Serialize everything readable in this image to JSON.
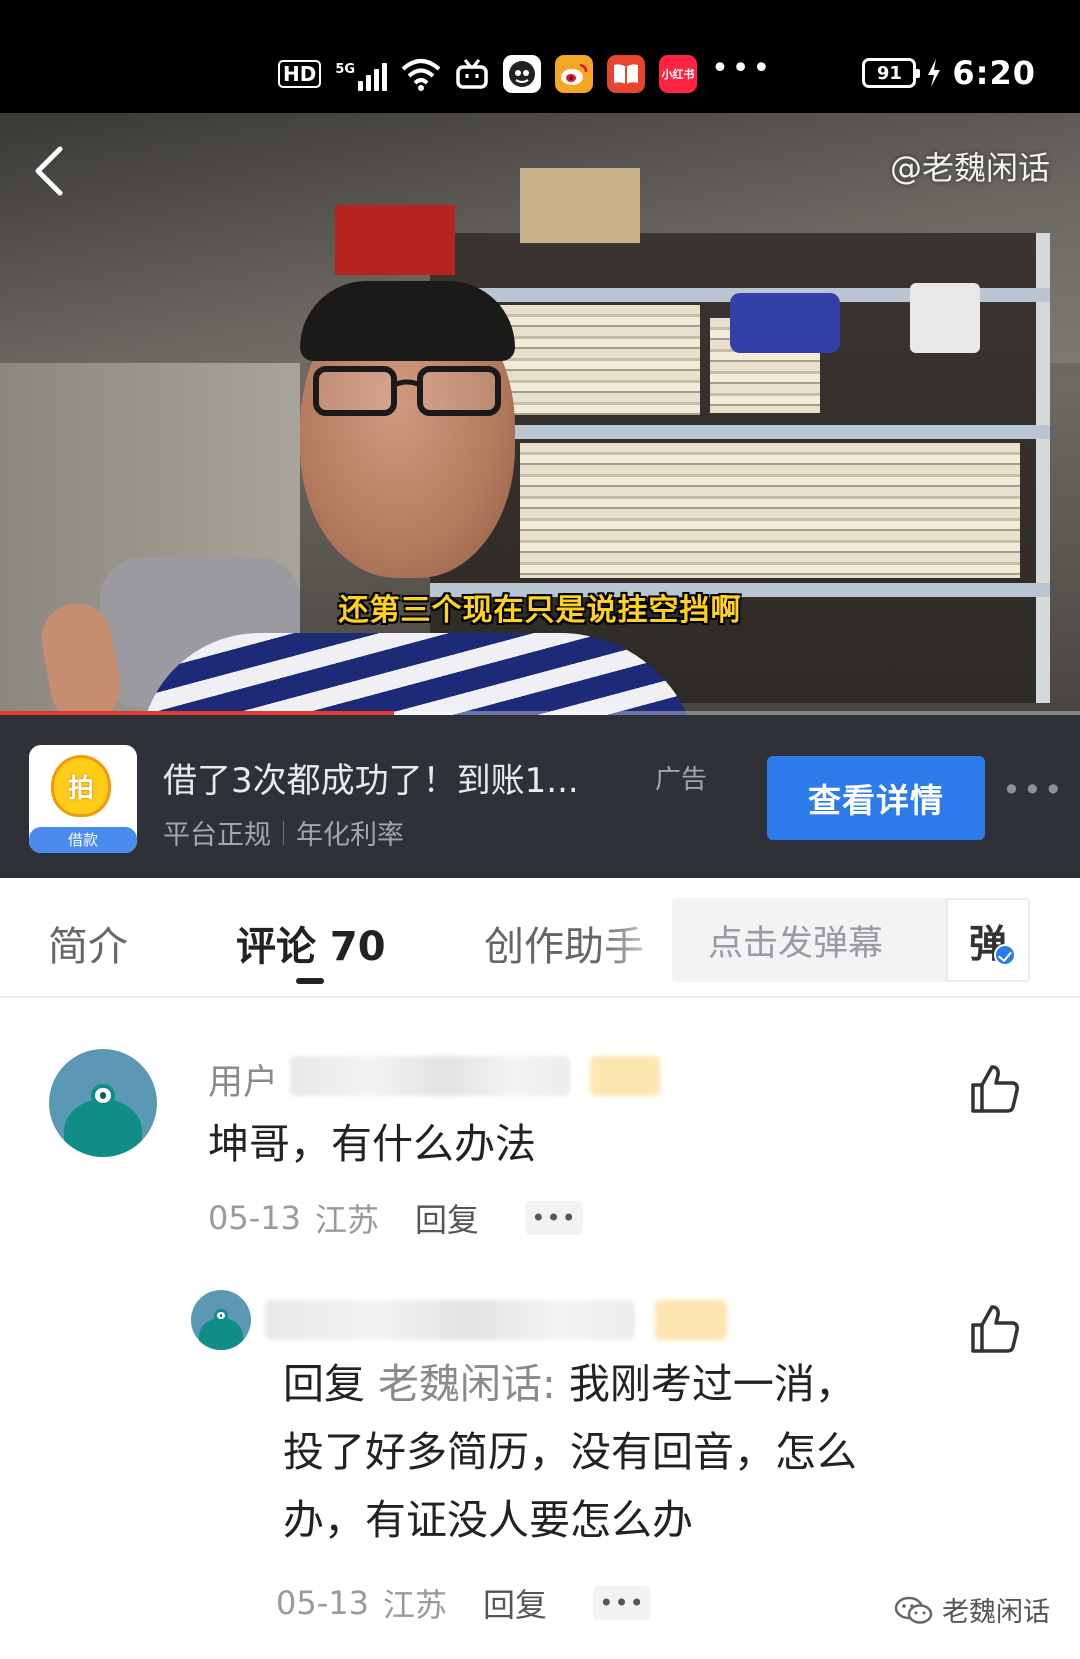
{
  "status_bar": {
    "hd": "HD",
    "network": "5G",
    "battery": "91",
    "time": "6:20",
    "app_icons": [
      "bilibili-icon",
      "avatar-app-icon",
      "weibo-icon",
      "reader-icon",
      "xiaohongshu-icon"
    ],
    "xiaohongshu_label": "小红书"
  },
  "video": {
    "watermark": "@老魏闲话",
    "subtitle": "还第三个现在只是说挂空挡啊",
    "progress": 0.365
  },
  "ad": {
    "logo_glyph": "拍",
    "logo_caption": "借款",
    "title": "借了3次都成功了！到账1...",
    "tag": "广告",
    "sub_1": "平台正规",
    "sub_2": "年化利率",
    "button": "查看详情"
  },
  "tabs": {
    "intro": "简介",
    "comments": "评论 70",
    "assistant": "创作助手",
    "danmu_placeholder": "点击发弹幕",
    "danmu_toggle": "弹"
  },
  "comments": [
    {
      "name_visible": "用户",
      "text": "坤哥，有什么办法",
      "date": "05-13",
      "location": "江苏",
      "reply_label": "回复"
    },
    {
      "reply_prefix": "回复 ",
      "mention": "老魏闲话:",
      "text_line1": " 我刚考过一消，",
      "text_line2": "投了好多简历，没有回音，怎么",
      "text_line3": "办，有证没人要怎么办",
      "date": "05-13",
      "location": "江苏",
      "reply_label": "回复"
    }
  ],
  "footer_watermark": "老魏闲话",
  "colors": {
    "accent_blue": "#2d7bea",
    "progress_red": "#e23a33",
    "subtitle_yellow": "#ffd21f"
  }
}
